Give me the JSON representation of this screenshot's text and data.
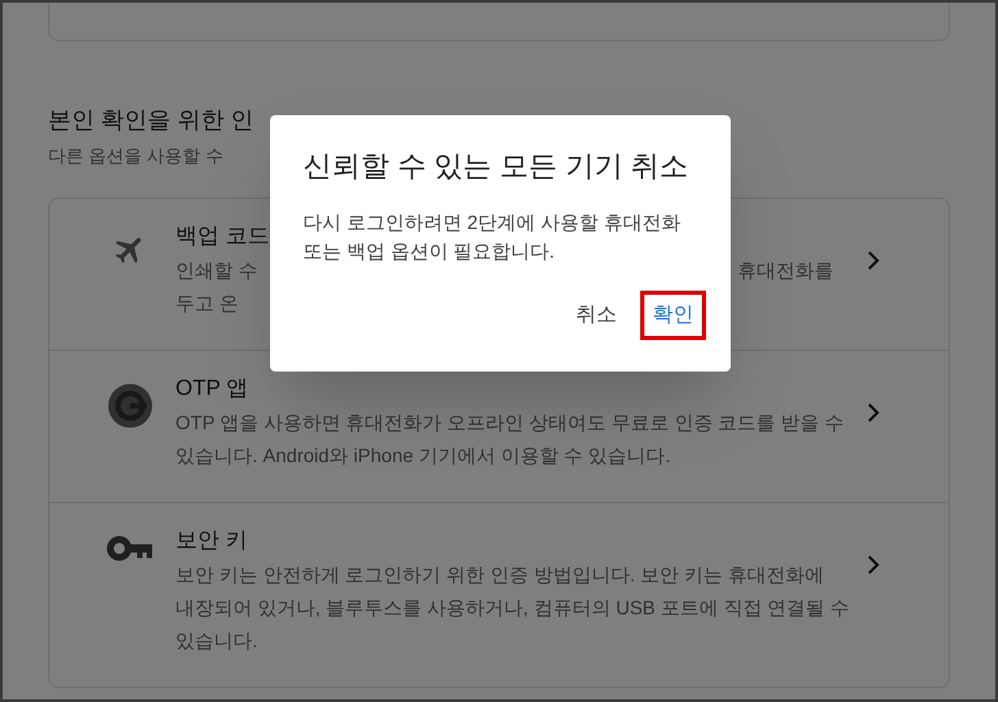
{
  "section": {
    "heading": "본인 확인을 위한 인",
    "subtitle": "다른 옵션을 사용할 수"
  },
  "options": [
    {
      "kind": "plane",
      "title": "백업 코드",
      "lines": [
        [
          "인쇄할 수",
          "휴대전화를"
        ],
        [
          "두고 온"
        ]
      ]
    },
    {
      "kind": "otp",
      "title": "OTP 앱",
      "lines": [
        [
          "OTP 앱을 사용하면 휴대전화가 오프라인 상태여도 무료로 인증 코드를 받을 수"
        ],
        [
          "있습니다. Android와 iPhone 기기에서 이용할 수 있습니다."
        ]
      ]
    },
    {
      "kind": "key",
      "title": "보안 키",
      "lines": [
        [
          "보안 키는 안전하게 로그인하기 위한 인증 방법입니다. 보안 키는 휴대전화에"
        ],
        [
          "내장되어 있거나, 블루투스를 사용하거나, 컴퓨터의 USB 포트에 직접 연결될 수"
        ],
        [
          "있습니다."
        ]
      ]
    }
  ],
  "dialog": {
    "title": "신뢰할 수 있는 모든 기기 취소",
    "body": "다시 로그인하려면 2단계에 사용할 휴대전화 또는 백업 옵션이 필요합니다.",
    "buttons": [
      {
        "label": "취소",
        "kind": "plain",
        "annotated": false
      },
      {
        "label": "확인",
        "kind": "primary",
        "annotated": true
      }
    ]
  }
}
